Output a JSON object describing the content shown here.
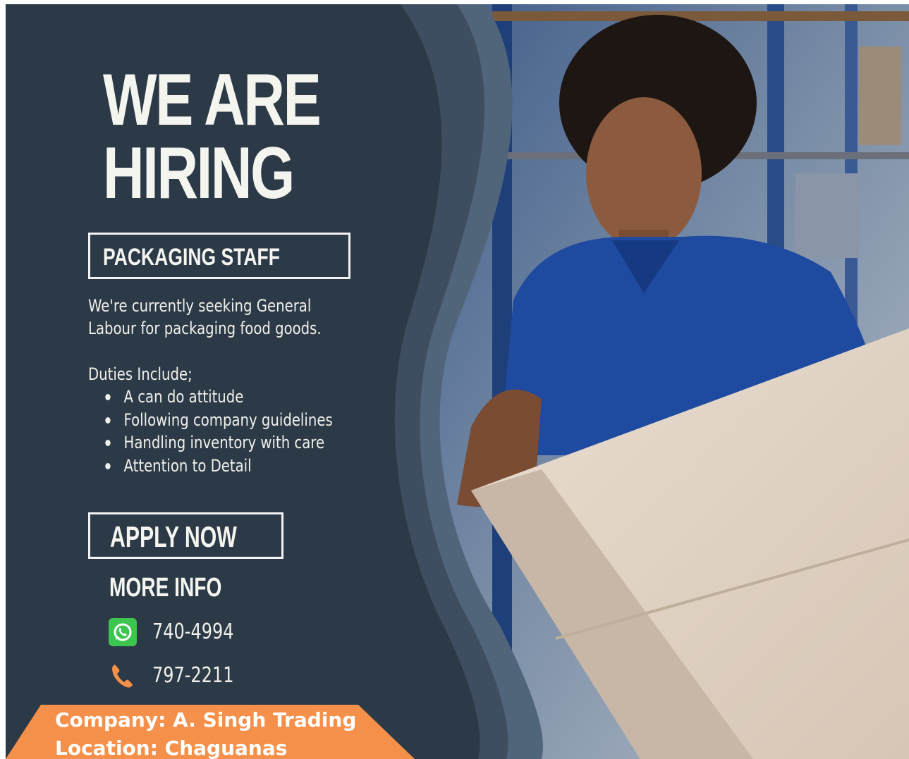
{
  "headline": {
    "line1": "WE ARE",
    "line2": "HIRING"
  },
  "position": "PACKAGING STAFF",
  "description": {
    "line1": "We're currently seeking General",
    "line2": "Labour for packaging food goods."
  },
  "duties": {
    "label": "Duties Include;",
    "items": [
      "A can do attitude",
      "Following company guidelines",
      "Handling inventory with care",
      "Attention to Detail"
    ]
  },
  "apply_label": "APPLY NOW",
  "more_info_label": "MORE INFO",
  "contacts": [
    {
      "icon": "whatsapp-icon",
      "number": "740-4994"
    },
    {
      "icon": "phone-icon",
      "number": "797-2211"
    }
  ],
  "company": {
    "line1": "Company: A. Singh Trading",
    "line2": "Location: Chaguanas"
  },
  "colors": {
    "panel": "#2c3a48",
    "wave_mid": "#3b4a5a",
    "wave_light": "#4e6072",
    "accent_orange": "#f5904a",
    "text": "#f5f5f0",
    "whatsapp": "#3cc54f"
  }
}
